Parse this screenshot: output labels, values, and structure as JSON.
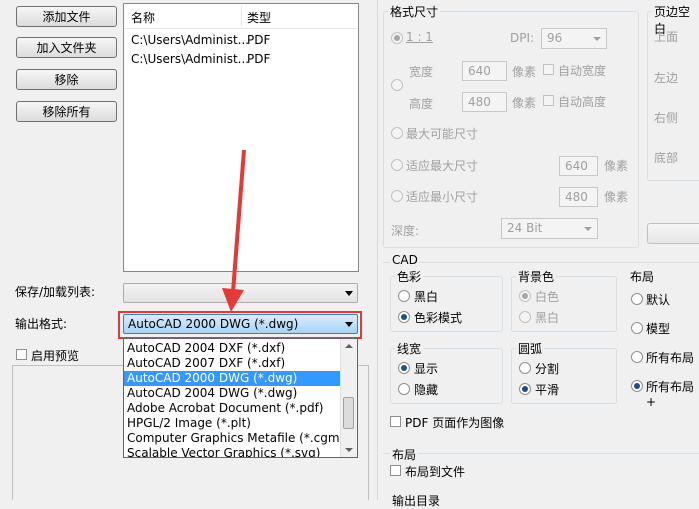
{
  "left": {
    "buttons": {
      "add_file": "添加文件",
      "add_folder": "加入文件夹",
      "remove": "移除",
      "remove_all": "移除所有"
    },
    "file_list": {
      "col_name": "名称",
      "col_type": "类型",
      "rows": [
        {
          "name": "C:\\Users\\Administ...",
          "type": "PDF"
        },
        {
          "name": "C:\\Users\\Administ...",
          "type": "PDF"
        }
      ]
    },
    "save_load_label": "保存/加载列表:",
    "output_format_label": "输出格式:",
    "output_format_selected": "AutoCAD 2000 DWG (*.dwg)",
    "enable_preview_label": "启用预览",
    "format_options": [
      "AutoCAD 2004 DXF (*.dxf)",
      "AutoCAD 2007 DXF (*.dxf)",
      "AutoCAD 2000 DWG (*.dwg)",
      "AutoCAD 2004 DWG (*.dwg)",
      "Adobe Acrobat Document (*.pdf)",
      "HPGL/2 Image (*.plt)",
      "Computer Graphics Metafile (*.cgm)",
      "Scalable Vector Graphics (*.svg)"
    ],
    "highlighted_option_index": 2
  },
  "format_size": {
    "title": "格式尺寸",
    "one_to_one": "1 : 1",
    "dpi_label": "DPI:",
    "dpi_value": "96",
    "width_label": "宽度",
    "width_value": "640",
    "width_unit": "像素",
    "auto_width": "自动宽度",
    "height_label": "高度",
    "height_value": "480",
    "height_unit": "像素",
    "auto_height": "自动高度",
    "max_size": "最大可能尺寸",
    "fit_max": "适应最大尺寸",
    "fit_max_value": "640",
    "fit_max_unit": "像素",
    "fit_min": "适应最小尺寸",
    "fit_min_value": "480",
    "fit_min_unit": "像素",
    "depth_label": "深度:",
    "depth_value": "24 Bit"
  },
  "margins": {
    "title": "页边空白",
    "top": "上面",
    "left": "左边",
    "right": "右侧",
    "bottom": "底部"
  },
  "cad": {
    "title": "CAD",
    "color": {
      "title": "色彩",
      "bw": "黑白",
      "color_mode": "色彩模式"
    },
    "background": {
      "title": "背景色",
      "white": "白色",
      "black": "黑白"
    },
    "layout": {
      "title": "布局",
      "default": "默认",
      "model": "模型",
      "all_layouts": "所有布局",
      "all_layouts_plus": "所有布局+"
    },
    "lineweight": {
      "title": "线宽",
      "show": "显示",
      "hide": "隐藏"
    },
    "arc": {
      "title": "圆弧",
      "split": "分割",
      "smooth": "平滑"
    },
    "pdf_page_as_image": "PDF 页面作为图像"
  },
  "layout_section": {
    "title": "布局",
    "layout_to_file": "布局到文件"
  },
  "output_dir": {
    "title": "输出目录"
  }
}
